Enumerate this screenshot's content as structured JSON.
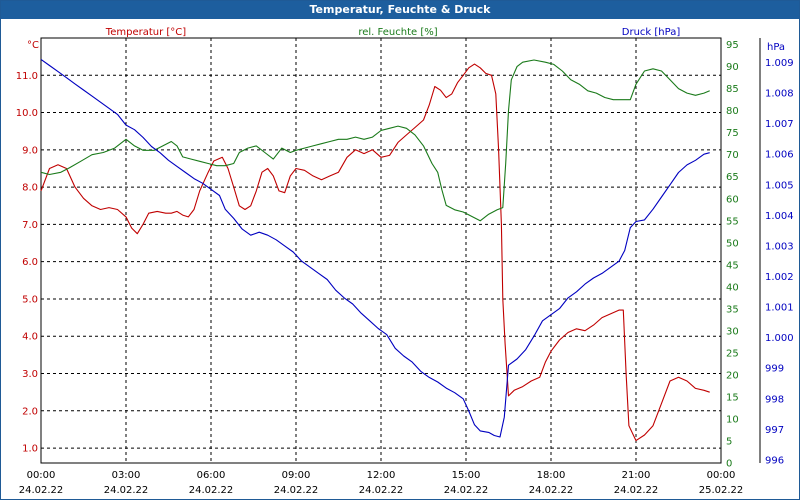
{
  "window": {
    "title": "Temperatur, Feuchte & Druck"
  },
  "colors": {
    "temperature": "#c00000",
    "humidity": "#1a7a1a",
    "pressure": "#0000c0",
    "titlebar": "#1d5e9e",
    "grid": "#000000"
  },
  "chart_data": {
    "type": "line",
    "title": "Temperatur, Feuchte & Druck",
    "grid": true,
    "x_ticks": [
      {
        "time": "00:00",
        "date": "24.02.22",
        "h": 0
      },
      {
        "time": "03:00",
        "date": "24.02.22",
        "h": 3
      },
      {
        "time": "06:00",
        "date": "24.02.22",
        "h": 6
      },
      {
        "time": "09:00",
        "date": "24.02.22",
        "h": 9
      },
      {
        "time": "12:00",
        "date": "24.02.22",
        "h": 12
      },
      {
        "time": "15:00",
        "date": "24.02.22",
        "h": 15
      },
      {
        "time": "18:00",
        "date": "24.02.22",
        "h": 18
      },
      {
        "time": "21:00",
        "date": "24.02.22",
        "h": 21
      },
      {
        "time": "00:00",
        "date": "25.02.22",
        "h": 24
      }
    ],
    "xlim": [
      0,
      24
    ],
    "axes": {
      "temperature": {
        "label": "Temperatur [°C]",
        "unit": "°C",
        "ylim": [
          0.6,
          12.0
        ],
        "ticks": [
          "1.0",
          "2.0",
          "3.0",
          "4.0",
          "5.0",
          "6.0",
          "7.0",
          "8.0",
          "9.0",
          "10.0",
          "11.0"
        ]
      },
      "humidity": {
        "label": "rel. Feuchte [%]",
        "unit": "%",
        "ylim": [
          0,
          96.5
        ],
        "ticks": [
          "0",
          "5",
          "10",
          "15",
          "20",
          "25",
          "30",
          "35",
          "40",
          "45",
          "50",
          "55",
          "60",
          "65",
          "70",
          "75",
          "80",
          "85",
          "90",
          "95"
        ]
      },
      "pressure": {
        "label": "Druck [hPa]",
        "unit": "hPa",
        "ylim": [
          995.9,
          1009.8
        ],
        "ticks": [
          "996",
          "997",
          "998",
          "999",
          "1.000",
          "1.001",
          "1.002",
          "1.003",
          "1.004",
          "1.005",
          "1.006",
          "1.007",
          "1.008",
          "1.009"
        ]
      }
    },
    "series": [
      {
        "name": "Temperatur [°C]",
        "axis": "temperature",
        "points": [
          [
            0,
            7.9
          ],
          [
            0.3,
            8.5
          ],
          [
            0.6,
            8.6
          ],
          [
            0.9,
            8.5
          ],
          [
            1.2,
            8.0
          ],
          [
            1.5,
            7.7
          ],
          [
            1.8,
            7.5
          ],
          [
            2.1,
            7.4
          ],
          [
            2.4,
            7.45
          ],
          [
            2.7,
            7.4
          ],
          [
            3.0,
            7.2
          ],
          [
            3.2,
            6.9
          ],
          [
            3.4,
            6.75
          ],
          [
            3.6,
            7.0
          ],
          [
            3.8,
            7.3
          ],
          [
            4.1,
            7.35
          ],
          [
            4.4,
            7.3
          ],
          [
            4.6,
            7.3
          ],
          [
            4.8,
            7.35
          ],
          [
            5.0,
            7.25
          ],
          [
            5.2,
            7.2
          ],
          [
            5.4,
            7.4
          ],
          [
            5.6,
            7.9
          ],
          [
            5.9,
            8.4
          ],
          [
            6.1,
            8.7
          ],
          [
            6.4,
            8.8
          ],
          [
            6.6,
            8.5
          ],
          [
            6.8,
            8.0
          ],
          [
            7.0,
            7.5
          ],
          [
            7.2,
            7.4
          ],
          [
            7.4,
            7.5
          ],
          [
            7.6,
            7.9
          ],
          [
            7.8,
            8.4
          ],
          [
            8.0,
            8.5
          ],
          [
            8.2,
            8.3
          ],
          [
            8.4,
            7.9
          ],
          [
            8.6,
            7.85
          ],
          [
            8.8,
            8.3
          ],
          [
            9.0,
            8.5
          ],
          [
            9.3,
            8.45
          ],
          [
            9.6,
            8.3
          ],
          [
            9.9,
            8.2
          ],
          [
            10.2,
            8.3
          ],
          [
            10.5,
            8.4
          ],
          [
            10.8,
            8.8
          ],
          [
            11.1,
            9.0
          ],
          [
            11.4,
            8.9
          ],
          [
            11.7,
            9.0
          ],
          [
            12.0,
            8.8
          ],
          [
            12.3,
            8.85
          ],
          [
            12.6,
            9.2
          ],
          [
            12.9,
            9.4
          ],
          [
            13.2,
            9.6
          ],
          [
            13.5,
            9.8
          ],
          [
            13.7,
            10.2
          ],
          [
            13.9,
            10.7
          ],
          [
            14.1,
            10.6
          ],
          [
            14.3,
            10.4
          ],
          [
            14.5,
            10.5
          ],
          [
            14.7,
            10.8
          ],
          [
            14.9,
            11.0
          ],
          [
            15.1,
            11.2
          ],
          [
            15.3,
            11.3
          ],
          [
            15.5,
            11.2
          ],
          [
            15.7,
            11.05
          ],
          [
            15.9,
            11.0
          ],
          [
            16.05,
            10.5
          ],
          [
            16.15,
            9.0
          ],
          [
            16.25,
            7.0
          ],
          [
            16.3,
            5.0
          ],
          [
            16.38,
            3.8
          ],
          [
            16.5,
            2.4
          ],
          [
            16.7,
            2.55
          ],
          [
            17.0,
            2.65
          ],
          [
            17.3,
            2.8
          ],
          [
            17.6,
            2.9
          ],
          [
            17.8,
            3.3
          ],
          [
            18.0,
            3.6
          ],
          [
            18.3,
            3.9
          ],
          [
            18.6,
            4.1
          ],
          [
            18.9,
            4.2
          ],
          [
            19.2,
            4.15
          ],
          [
            19.5,
            4.3
          ],
          [
            19.8,
            4.5
          ],
          [
            20.1,
            4.6
          ],
          [
            20.4,
            4.7
          ],
          [
            20.55,
            4.7
          ],
          [
            20.65,
            3.0
          ],
          [
            20.75,
            1.6
          ],
          [
            21.0,
            1.2
          ],
          [
            21.3,
            1.35
          ],
          [
            21.6,
            1.6
          ],
          [
            21.9,
            2.2
          ],
          [
            22.2,
            2.8
          ],
          [
            22.5,
            2.9
          ],
          [
            22.8,
            2.8
          ],
          [
            23.1,
            2.6
          ],
          [
            23.4,
            2.55
          ],
          [
            23.6,
            2.5
          ]
        ]
      },
      {
        "name": "rel. Feuchte [%]",
        "axis": "humidity",
        "points": [
          [
            0,
            66
          ],
          [
            0.3,
            65.5
          ],
          [
            0.7,
            66
          ],
          [
            1.0,
            67
          ],
          [
            1.4,
            68.5
          ],
          [
            1.8,
            70
          ],
          [
            2.2,
            70.5
          ],
          [
            2.6,
            71.5
          ],
          [
            3.0,
            73.5
          ],
          [
            3.3,
            72
          ],
          [
            3.6,
            71
          ],
          [
            4.0,
            71
          ],
          [
            4.3,
            72
          ],
          [
            4.6,
            73
          ],
          [
            4.8,
            72
          ],
          [
            5.0,
            69.5
          ],
          [
            5.3,
            69
          ],
          [
            5.6,
            68.5
          ],
          [
            5.9,
            68
          ],
          [
            6.2,
            67.5
          ],
          [
            6.5,
            67.5
          ],
          [
            6.8,
            68
          ],
          [
            7.0,
            70.5
          ],
          [
            7.3,
            71.5
          ],
          [
            7.6,
            72
          ],
          [
            7.9,
            70.5
          ],
          [
            8.2,
            69
          ],
          [
            8.5,
            71.5
          ],
          [
            8.8,
            70.5
          ],
          [
            9.0,
            71
          ],
          [
            9.3,
            71.5
          ],
          [
            9.6,
            72
          ],
          [
            9.9,
            72.5
          ],
          [
            10.2,
            73
          ],
          [
            10.5,
            73.5
          ],
          [
            10.8,
            73.5
          ],
          [
            11.1,
            74
          ],
          [
            11.4,
            73.5
          ],
          [
            11.7,
            74
          ],
          [
            12.0,
            75.5
          ],
          [
            12.3,
            76
          ],
          [
            12.6,
            76.5
          ],
          [
            12.9,
            76
          ],
          [
            13.2,
            74.5
          ],
          [
            13.5,
            72
          ],
          [
            13.8,
            68
          ],
          [
            14.0,
            66
          ],
          [
            14.15,
            62
          ],
          [
            14.3,
            58.5
          ],
          [
            14.6,
            57.5
          ],
          [
            14.9,
            57
          ],
          [
            15.2,
            56
          ],
          [
            15.5,
            55
          ],
          [
            15.8,
            56.5
          ],
          [
            16.1,
            57.5
          ],
          [
            16.3,
            58
          ],
          [
            16.4,
            68
          ],
          [
            16.5,
            80
          ],
          [
            16.6,
            87
          ],
          [
            16.8,
            90
          ],
          [
            17.0,
            91
          ],
          [
            17.4,
            91.5
          ],
          [
            17.8,
            91
          ],
          [
            18.1,
            90.5
          ],
          [
            18.4,
            89
          ],
          [
            18.7,
            87
          ],
          [
            19.0,
            86
          ],
          [
            19.3,
            84.5
          ],
          [
            19.6,
            84
          ],
          [
            19.9,
            83
          ],
          [
            20.2,
            82.5
          ],
          [
            20.5,
            82.5
          ],
          [
            20.8,
            82.5
          ],
          [
            21.0,
            86
          ],
          [
            21.3,
            89
          ],
          [
            21.6,
            89.5
          ],
          [
            21.9,
            89
          ],
          [
            22.2,
            87
          ],
          [
            22.5,
            85
          ],
          [
            22.8,
            84
          ],
          [
            23.1,
            83.5
          ],
          [
            23.4,
            84
          ],
          [
            23.6,
            84.5
          ]
        ]
      },
      {
        "name": "Druck [hPa]",
        "axis": "pressure",
        "points": [
          [
            0,
            1009.1
          ],
          [
            0.3,
            1008.9
          ],
          [
            0.6,
            1008.7
          ],
          [
            0.9,
            1008.5
          ],
          [
            1.2,
            1008.3
          ],
          [
            1.5,
            1008.1
          ],
          [
            1.8,
            1007.9
          ],
          [
            2.1,
            1007.7
          ],
          [
            2.4,
            1007.5
          ],
          [
            2.7,
            1007.3
          ],
          [
            3.0,
            1006.95
          ],
          [
            3.3,
            1006.8
          ],
          [
            3.6,
            1006.55
          ],
          [
            3.9,
            1006.25
          ],
          [
            4.2,
            1006.05
          ],
          [
            4.5,
            1005.8
          ],
          [
            4.8,
            1005.6
          ],
          [
            5.1,
            1005.4
          ],
          [
            5.4,
            1005.2
          ],
          [
            5.7,
            1005.05
          ],
          [
            6.0,
            1004.85
          ],
          [
            6.3,
            1004.65
          ],
          [
            6.5,
            1004.2
          ],
          [
            6.8,
            1003.9
          ],
          [
            7.1,
            1003.55
          ],
          [
            7.4,
            1003.35
          ],
          [
            7.7,
            1003.45
          ],
          [
            8.0,
            1003.35
          ],
          [
            8.3,
            1003.2
          ],
          [
            8.6,
            1003.0
          ],
          [
            8.9,
            1002.8
          ],
          [
            9.2,
            1002.5
          ],
          [
            9.5,
            1002.3
          ],
          [
            9.8,
            1002.1
          ],
          [
            10.1,
            1001.9
          ],
          [
            10.4,
            1001.55
          ],
          [
            10.7,
            1001.3
          ],
          [
            11.0,
            1001.1
          ],
          [
            11.3,
            1000.8
          ],
          [
            11.6,
            1000.55
          ],
          [
            11.9,
            1000.3
          ],
          [
            12.2,
            1000.1
          ],
          [
            12.5,
            999.65
          ],
          [
            12.8,
            999.4
          ],
          [
            13.1,
            999.2
          ],
          [
            13.4,
            998.9
          ],
          [
            13.7,
            998.7
          ],
          [
            14.0,
            998.55
          ],
          [
            14.3,
            998.35
          ],
          [
            14.6,
            998.2
          ],
          [
            14.9,
            998.0
          ],
          [
            15.1,
            997.6
          ],
          [
            15.3,
            997.15
          ],
          [
            15.5,
            996.95
          ],
          [
            15.8,
            996.9
          ],
          [
            16.0,
            996.8
          ],
          [
            16.2,
            996.75
          ],
          [
            16.35,
            997.4
          ],
          [
            16.5,
            999.1
          ],
          [
            16.8,
            999.3
          ],
          [
            17.1,
            999.6
          ],
          [
            17.4,
            1000.05
          ],
          [
            17.7,
            1000.55
          ],
          [
            18.0,
            1000.75
          ],
          [
            18.3,
            1000.95
          ],
          [
            18.6,
            1001.3
          ],
          [
            18.9,
            1001.5
          ],
          [
            19.2,
            1001.75
          ],
          [
            19.5,
            1001.95
          ],
          [
            19.8,
            1002.1
          ],
          [
            20.1,
            1002.3
          ],
          [
            20.4,
            1002.5
          ],
          [
            20.6,
            1002.85
          ],
          [
            20.8,
            1003.6
          ],
          [
            21.0,
            1003.8
          ],
          [
            21.3,
            1003.85
          ],
          [
            21.6,
            1004.2
          ],
          [
            21.9,
            1004.6
          ],
          [
            22.2,
            1005.0
          ],
          [
            22.5,
            1005.4
          ],
          [
            22.8,
            1005.65
          ],
          [
            23.1,
            1005.8
          ],
          [
            23.4,
            1006.0
          ],
          [
            23.6,
            1006.05
          ]
        ]
      }
    ]
  }
}
